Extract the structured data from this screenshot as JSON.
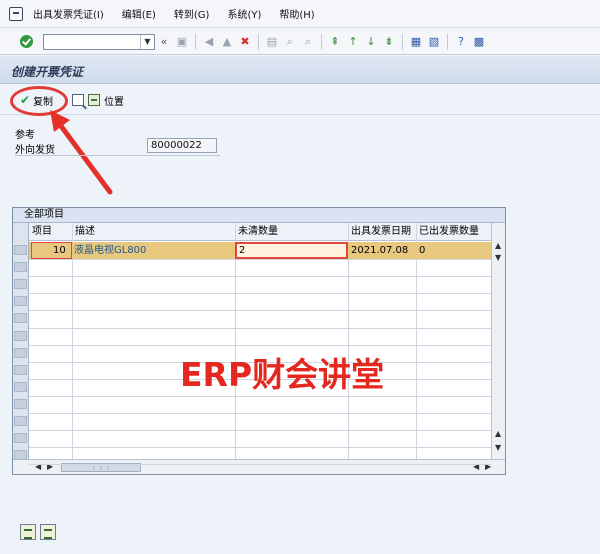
{
  "menu": {
    "items": [
      "出具发票凭证(I)",
      "编辑(E)",
      "转到(G)",
      "系统(Y)",
      "帮助(H)"
    ]
  },
  "toolbar": {
    "command_field_value": "",
    "nav_back_glyph": "«"
  },
  "screen": {
    "title": "创建开票凭证"
  },
  "app_toolbar": {
    "copy_label": "复制",
    "position_label": "位置"
  },
  "reference": {
    "section_label": "参考",
    "delivery_label": "外向发货",
    "delivery_value": "80000022"
  },
  "table": {
    "title": "全部项目",
    "columns": [
      "项目",
      "描述",
      "未清数量",
      "出具发票日期",
      "已出发票数量"
    ],
    "rows": [
      {
        "item": "10",
        "description": "液晶电视GL800",
        "open_qty": "2",
        "billing_date": "2021.07.08",
        "billed_qty": "0"
      }
    ]
  },
  "watermark": "ERP财会讲堂",
  "colors": {
    "highlight_red": "#e23b37",
    "row_selected": "#e8c77f",
    "ok_green": "#2f9a3a"
  }
}
